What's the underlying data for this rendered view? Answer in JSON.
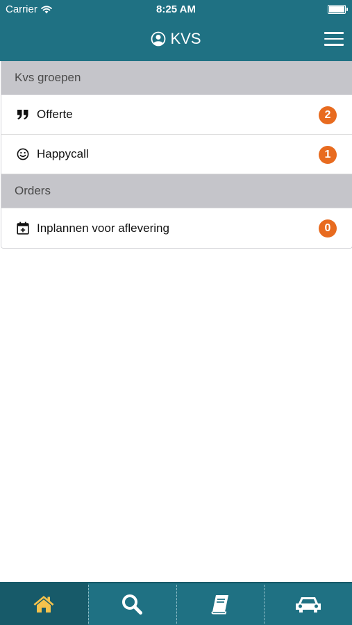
{
  "status_bar": {
    "carrier": "Carrier",
    "time": "8:25 AM"
  },
  "header": {
    "title": "KVS",
    "title_icon": "user-circle-icon",
    "menu_icon": "hamburger-menu-icon"
  },
  "sections": [
    {
      "title": "Kvs groepen",
      "items": [
        {
          "label": "Offerte",
          "icon": "quote-icon",
          "count": "2"
        },
        {
          "label": "Happycall",
          "icon": "smiley-icon",
          "count": "1"
        }
      ]
    },
    {
      "title": "Orders",
      "items": [
        {
          "label": "Inplannen voor aflevering",
          "icon": "calendar-plus-icon",
          "count": "0"
        }
      ]
    }
  ],
  "tabbar": {
    "tabs": [
      {
        "icon": "home-icon",
        "active": true
      },
      {
        "icon": "search-icon",
        "active": false
      },
      {
        "icon": "book-icon",
        "active": false
      },
      {
        "icon": "car-icon",
        "active": false
      }
    ]
  },
  "colors": {
    "primary": "#1f7183",
    "badge": "#e86b1f",
    "active_icon": "#f5c24c",
    "section_bg": "#c5c5ca"
  }
}
